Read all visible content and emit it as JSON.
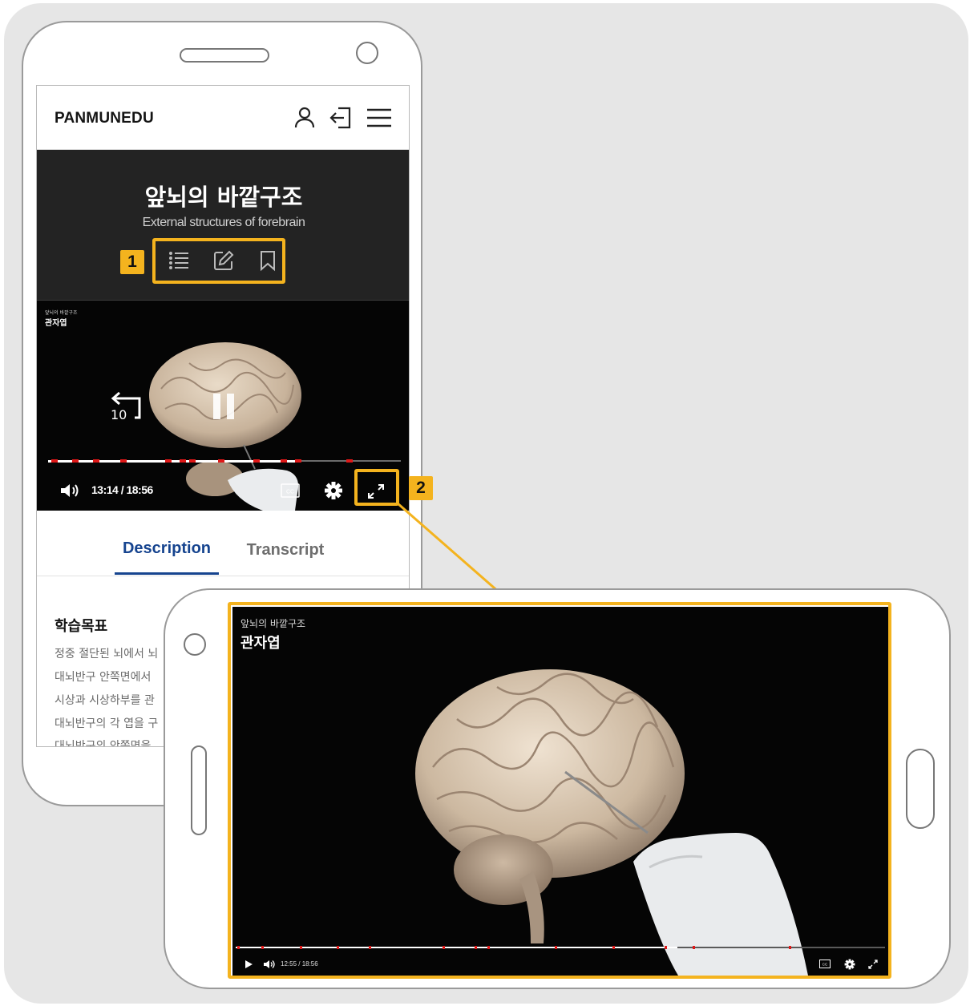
{
  "header": {
    "logo": "PANMUNEDU",
    "icons": [
      "user-icon",
      "logout-icon",
      "menu-icon"
    ]
  },
  "lesson": {
    "title": "앞뇌의 바깥구조",
    "subtitle": "External structures of forebrain",
    "tools": [
      "list-icon",
      "edit-icon",
      "bookmark-icon"
    ]
  },
  "video_portrait": {
    "overlay_caption": "앞뇌의 바깥구조",
    "overlay_title": "관자엽",
    "rewind_label": "10",
    "time_current": "13:14",
    "time_separator": "/",
    "time_total": "18:56",
    "progress_fraction": 0.7
  },
  "tabs": [
    {
      "label": "Description",
      "active": true
    },
    {
      "label": "Transcript",
      "active": false
    }
  ],
  "objectives": {
    "title": "학습목표",
    "items": [
      "정중 절단된 뇌에서 뇌",
      "대뇌반구 안쪽면에서",
      "시상과 시상하부를 관",
      "대뇌반구의 각 엽을 구",
      "대뇌반구의 안쪽면을"
    ]
  },
  "callouts": {
    "one": "1",
    "two": "2"
  },
  "video_landscape": {
    "overlay_caption": "앞뇌의 바깥구조",
    "overlay_title": "관자엽",
    "time_label": "12:55 / 18:56",
    "progress_fraction": 0.68
  },
  "colors": {
    "accent": "#f4b31e",
    "tab_active": "#16448f",
    "progress_marker": "#e01818"
  }
}
